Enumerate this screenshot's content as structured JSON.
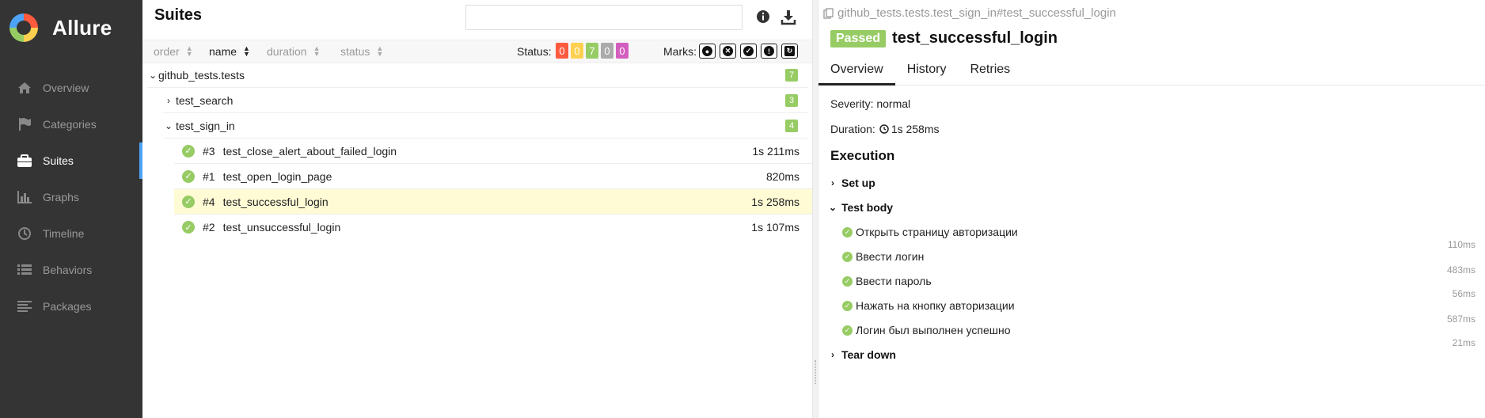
{
  "brand": {
    "name": "Allure"
  },
  "nav": [
    {
      "label": "Overview",
      "icon": "home-icon"
    },
    {
      "label": "Categories",
      "icon": "flag-icon"
    },
    {
      "label": "Suites",
      "icon": "briefcase-icon"
    },
    {
      "label": "Graphs",
      "icon": "bar-chart-icon"
    },
    {
      "label": "Timeline",
      "icon": "clock-icon"
    },
    {
      "label": "Behaviors",
      "icon": "list-icon"
    },
    {
      "label": "Packages",
      "icon": "align-left-icon"
    }
  ],
  "nav_active": "Suites",
  "suites": {
    "title": "Suites",
    "search": {
      "value": "",
      "placeholder": ""
    },
    "sort": {
      "order": "order",
      "name": "name",
      "duration": "duration",
      "status": "status"
    },
    "status_label": "Status:",
    "status_counts": [
      {
        "value": "0",
        "color": "#fd5a3e"
      },
      {
        "value": "0",
        "color": "#ffd050"
      },
      {
        "value": "7",
        "color": "#97cc64"
      },
      {
        "value": "0",
        "color": "#aaaaaa"
      },
      {
        "value": "0",
        "color": "#d35ebe"
      }
    ],
    "marks_label": "Marks:",
    "tree": {
      "root": {
        "name": "github_tests.tests",
        "count": "7"
      },
      "groups": [
        {
          "name": "test_search",
          "count": "3"
        },
        {
          "name": "test_sign_in",
          "count": "4"
        }
      ],
      "tests": [
        {
          "num": "#3",
          "name": "test_close_alert_about_failed_login",
          "duration": "1s 211ms"
        },
        {
          "num": "#1",
          "name": "test_open_login_page",
          "duration": "820ms"
        },
        {
          "num": "#4",
          "name": "test_successful_login",
          "duration": "1s 258ms"
        },
        {
          "num": "#2",
          "name": "test_unsuccessful_login",
          "duration": "1s 107ms"
        }
      ]
    }
  },
  "result": {
    "path": "github_tests.tests.test_sign_in#test_successful_login",
    "status_badge": "Passed",
    "name": "test_successful_login",
    "tabs": [
      "Overview",
      "History",
      "Retries"
    ],
    "severity": "Severity: normal",
    "duration_label": "Duration:",
    "duration": "1s 258ms",
    "execution_title": "Execution",
    "setup": "Set up",
    "test_body": "Test body",
    "teardown": "Tear down",
    "steps": [
      {
        "name": "Открыть страницу авторизации",
        "duration": "110ms"
      },
      {
        "name": "Ввести логин",
        "duration": "483ms"
      },
      {
        "name": "Ввести пароль",
        "duration": "56ms"
      },
      {
        "name": "Нажать на кнопку авторизации",
        "duration": "587ms"
      },
      {
        "name": "Логин был выполнен успешно",
        "duration": "21ms"
      }
    ]
  },
  "colors": {
    "passed": "#97cc64",
    "sidebar": "#343434",
    "accent": "#4fa3f7",
    "selected_row": "#fffbd5"
  }
}
